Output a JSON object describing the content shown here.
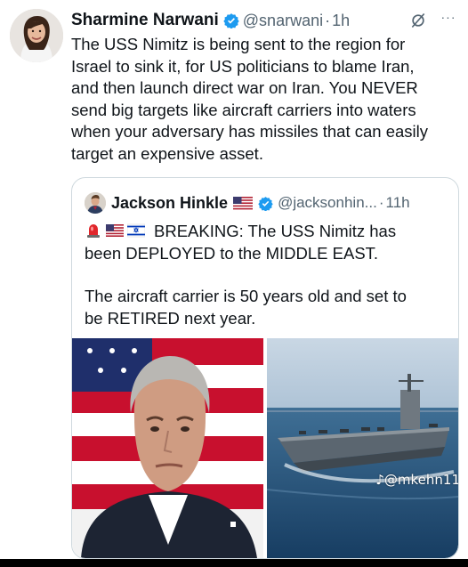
{
  "tweet": {
    "author_name": "Sharmine Narwani",
    "handle": "@snarwani",
    "separator": "·",
    "time": "1h",
    "text_lines": [
      "The USS Nimitz is being sent to the region for",
      "Israel to sink it, for US politicians to blame Iran,",
      "and then launch direct war on Iran. You NEVER",
      "send big targets like aircraft carriers into waters",
      "when your adversary has missiles that can easily",
      "target an expensive asset."
    ],
    "more_label": "···"
  },
  "quote": {
    "author_name": "Jackson Hinkle",
    "handle": "@jacksonhin...",
    "separator": "·",
    "time": "11h",
    "text_line1": "BREAKING: The USS Nimitz has",
    "text_line2": "been DEPLOYED to the MIDDLE EAST.",
    "text_line3": "The aircraft carrier is 50 years old and set to",
    "text_line4": "be RETIRED next year.",
    "emojis": [
      "siren-emoji",
      "us-flag-emoji",
      "israel-flag-emoji"
    ]
  },
  "media": {
    "left": "portrait-photo",
    "right": "aircraft-carrier-photo",
    "watermark": "♪@mkehn11"
  },
  "colors": {
    "text": "#0f1419",
    "secondary": "#536471",
    "verified_blue": "#1d9bf0",
    "border": "#cfd9de"
  }
}
